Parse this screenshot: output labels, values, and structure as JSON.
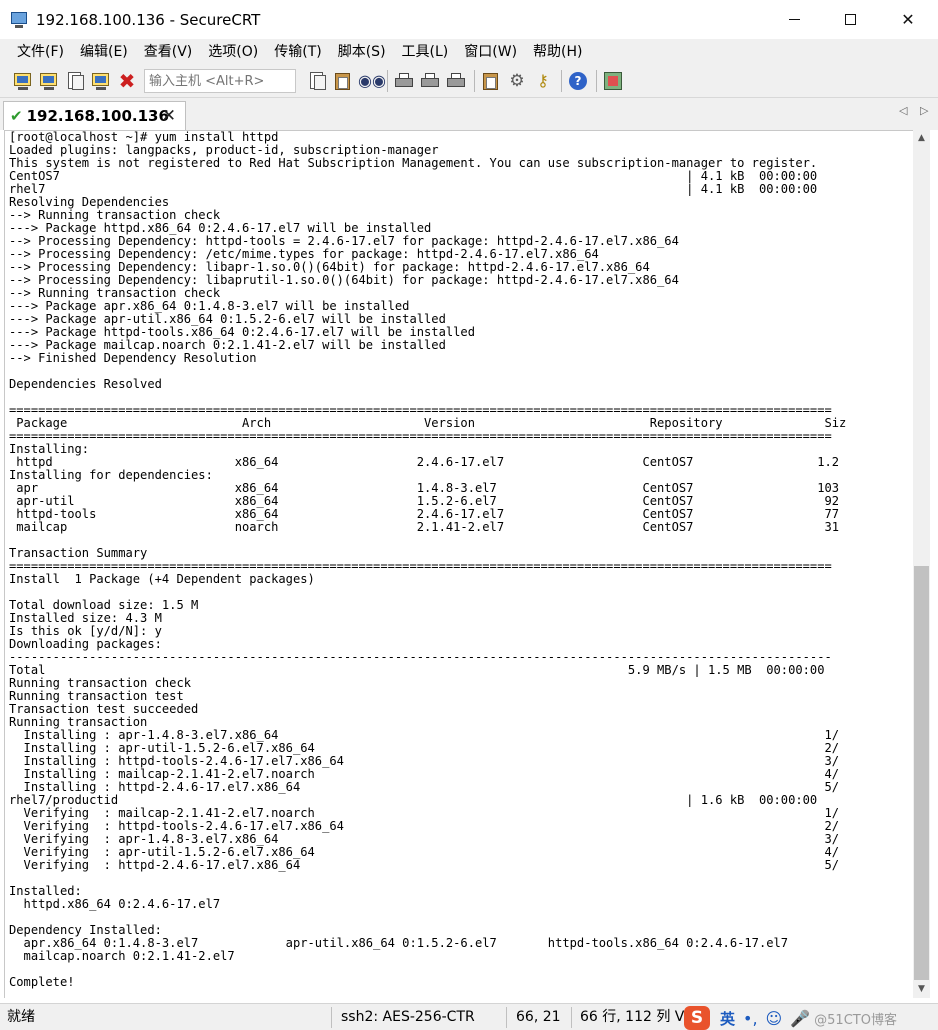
{
  "window": {
    "title": "192.168.100.136 - SecureCRT"
  },
  "menu": [
    "文件(F)",
    "编辑(E)",
    "查看(V)",
    "选项(O)",
    "传输(T)",
    "脚本(S)",
    "工具(L)",
    "窗口(W)",
    "帮助(H)"
  ],
  "toolbar": {
    "host_placeholder": "输入主机 <Alt+R>"
  },
  "tab": {
    "label": "192.168.100.136",
    "close": "✕"
  },
  "terminal": {
    "lines": [
      "[root@localhost ~]# yum install httpd",
      "Loaded plugins: langpacks, product-id, subscription-manager",
      "This system is not registered to Red Hat Subscription Management. You can use subscription-manager to register.",
      "CentOS7                                                                                      | 4.1 kB  00:00:00",
      "rhel7                                                                                        | 4.1 kB  00:00:00",
      "Resolving Dependencies",
      "--> Running transaction check",
      "---> Package httpd.x86_64 0:2.4.6-17.el7 will be installed",
      "--> Processing Dependency: httpd-tools = 2.4.6-17.el7 for package: httpd-2.4.6-17.el7.x86_64",
      "--> Processing Dependency: /etc/mime.types for package: httpd-2.4.6-17.el7.x86_64",
      "--> Processing Dependency: libapr-1.so.0()(64bit) for package: httpd-2.4.6-17.el7.x86_64",
      "--> Processing Dependency: libaprutil-1.so.0()(64bit) for package: httpd-2.4.6-17.el7.x86_64",
      "--> Running transaction check",
      "---> Package apr.x86_64 0:1.4.8-3.el7 will be installed",
      "---> Package apr-util.x86_64 0:1.5.2-6.el7 will be installed",
      "---> Package httpd-tools.x86_64 0:2.4.6-17.el7 will be installed",
      "---> Package mailcap.noarch 0:2.1.41-2.el7 will be installed",
      "--> Finished Dependency Resolution",
      "",
      "Dependencies Resolved",
      "",
      "=================================================================================================================",
      " Package                        Arch                     Version                        Repository              Siz",
      "=================================================================================================================",
      "Installing:",
      " httpd                         x86_64                   2.4.6-17.el7                   CentOS7                 1.2",
      "Installing for dependencies:",
      " apr                           x86_64                   1.4.8-3.el7                    CentOS7                 103",
      " apr-util                      x86_64                   1.5.2-6.el7                    CentOS7                  92",
      " httpd-tools                   x86_64                   2.4.6-17.el7                   CentOS7                  77",
      " mailcap                       noarch                   2.1.41-2.el7                   CentOS7                  31",
      "",
      "Transaction Summary",
      "=================================================================================================================",
      "Install  1 Package (+4 Dependent packages)",
      "",
      "Total download size: 1.5 M",
      "Installed size: 4.3 M",
      "Is this ok [y/d/N]: y",
      "Downloading packages:",
      "-----------------------------------------------------------------------------------------------------------------",
      "Total                                                                                5.9 MB/s | 1.5 MB  00:00:00",
      "Running transaction check",
      "Running transaction test",
      "Transaction test succeeded",
      "Running transaction",
      "  Installing : apr-1.4.8-3.el7.x86_64                                                                           1/",
      "  Installing : apr-util-1.5.2-6.el7.x86_64                                                                      2/",
      "  Installing : httpd-tools-2.4.6-17.el7.x86_64                                                                  3/",
      "  Installing : mailcap-2.1.41-2.el7.noarch                                                                      4/",
      "  Installing : httpd-2.4.6-17.el7.x86_64                                                                        5/",
      "rhel7/productid                                                                              | 1.6 kB  00:00:00",
      "  Verifying  : mailcap-2.1.41-2.el7.noarch                                                                      1/",
      "  Verifying  : httpd-tools-2.4.6-17.el7.x86_64                                                                  2/",
      "  Verifying  : apr-1.4.8-3.el7.x86_64                                                                           3/",
      "  Verifying  : apr-util-1.5.2-6.el7.x86_64                                                                      4/",
      "  Verifying  : httpd-2.4.6-17.el7.x86_64                                                                        5/",
      "",
      "Installed:",
      "  httpd.x86_64 0:2.4.6-17.el7",
      "",
      "Dependency Installed:",
      "  apr.x86_64 0:1.4.8-3.el7            apr-util.x86_64 0:1.5.2-6.el7       httpd-tools.x86_64 0:2.4.6-17.el7",
      "  mailcap.noarch 0:2.1.41-2.el7",
      "",
      "Complete!"
    ]
  },
  "status": {
    "ready": "就绪",
    "ssh": "ssh2: AES-256-CTR",
    "position": "66, 21",
    "size": "66 行, 112 列 V",
    "ime_logo": "S",
    "ime_lang": "英",
    "watermark": "@51CTO博客"
  }
}
